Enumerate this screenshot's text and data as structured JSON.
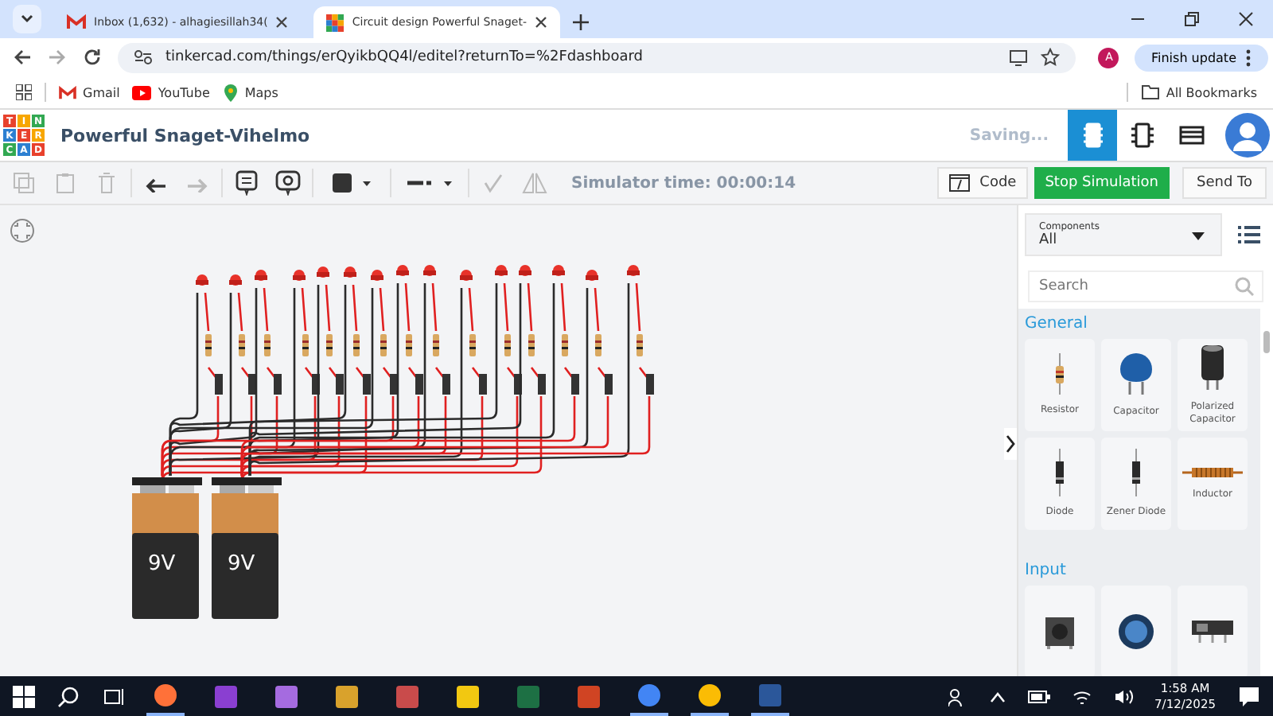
{
  "browser": {
    "tabs": [
      {
        "title": "Inbox (1,632) - alhagiesillah34(",
        "selected": false
      },
      {
        "title": "Circuit design Powerful Snaget-",
        "selected": true
      }
    ],
    "url": "tinkercad.com/things/erQyikbQQ4l/editel?returnTo=%2Fdashboard",
    "profile_initial": "A",
    "update_button": "Finish update",
    "bookmarks": [
      {
        "label": "Gmail"
      },
      {
        "label": "YouTube"
      },
      {
        "label": "Maps"
      }
    ],
    "all_bookmarks": "All Bookmarks"
  },
  "app": {
    "logo_letters": [
      "T",
      "I",
      "N",
      "K",
      "E",
      "R",
      "C",
      "A",
      "D"
    ],
    "title": "Powerful Snaget-Vihelmo",
    "status": "Saving...",
    "views": [
      {
        "kind": "circuit",
        "selected": true
      },
      {
        "kind": "schematic",
        "selected": false
      },
      {
        "kind": "bom",
        "selected": false
      }
    ]
  },
  "toolbar": {
    "simulator_time": "Simulator time: 00:00:14",
    "code_button": "Code",
    "stop_button": "Stop Simulation",
    "send_button": "Send To"
  },
  "canvas": {
    "batteries": [
      {
        "label": "9V"
      },
      {
        "label": "9V"
      }
    ]
  },
  "panel": {
    "dropdown_label": "Components",
    "dropdown_value": "All",
    "search_placeholder": "Search",
    "categories": [
      {
        "title": "General",
        "items": [
          {
            "kind": "resistor",
            "label": "Resistor"
          },
          {
            "kind": "capacitor",
            "label": "Capacitor"
          },
          {
            "kind": "polarized",
            "label": "Polarized Capacitor"
          },
          {
            "kind": "diode",
            "label": "Diode"
          },
          {
            "kind": "diode",
            "label": "Zener Diode"
          },
          {
            "kind": "inductor",
            "label": "Inductor"
          }
        ]
      },
      {
        "title": "Input",
        "items": [
          {
            "kind": "pushbutton"
          },
          {
            "kind": "potentiometer"
          },
          {
            "kind": "slideswitch"
          }
        ]
      }
    ]
  },
  "taskbar": {
    "time": "1:58 AM",
    "date": "7/12/2025"
  }
}
